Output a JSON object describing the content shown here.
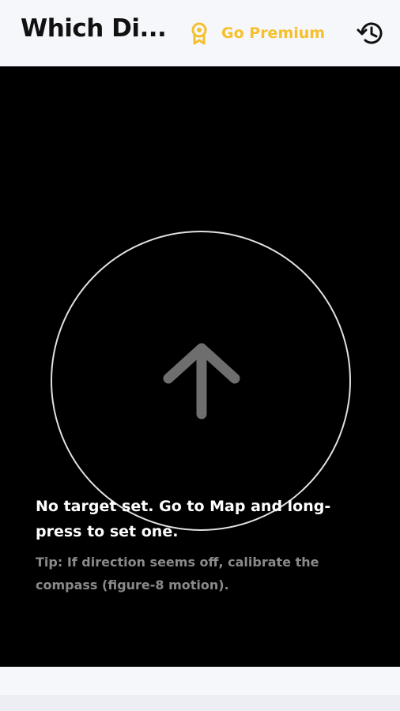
{
  "app_bar": {
    "title": "Which Di...",
    "premium_label": "Go Premium",
    "premium_icon": "award-badge-icon",
    "history_icon": "history-icon"
  },
  "compass": {
    "arrow_icon": "arrow-up-icon",
    "message": "No target set. Go to Map and long-press to set one.",
    "tip": "Tip: If direction seems off, calibrate the compass (figure-8 motion)."
  },
  "colors": {
    "accent": "#f5c02b",
    "panel_background": "#000000",
    "app_background": "#f6f7fb",
    "tip_text": "#8a8a8a",
    "arrow": "#6e6e6e"
  }
}
